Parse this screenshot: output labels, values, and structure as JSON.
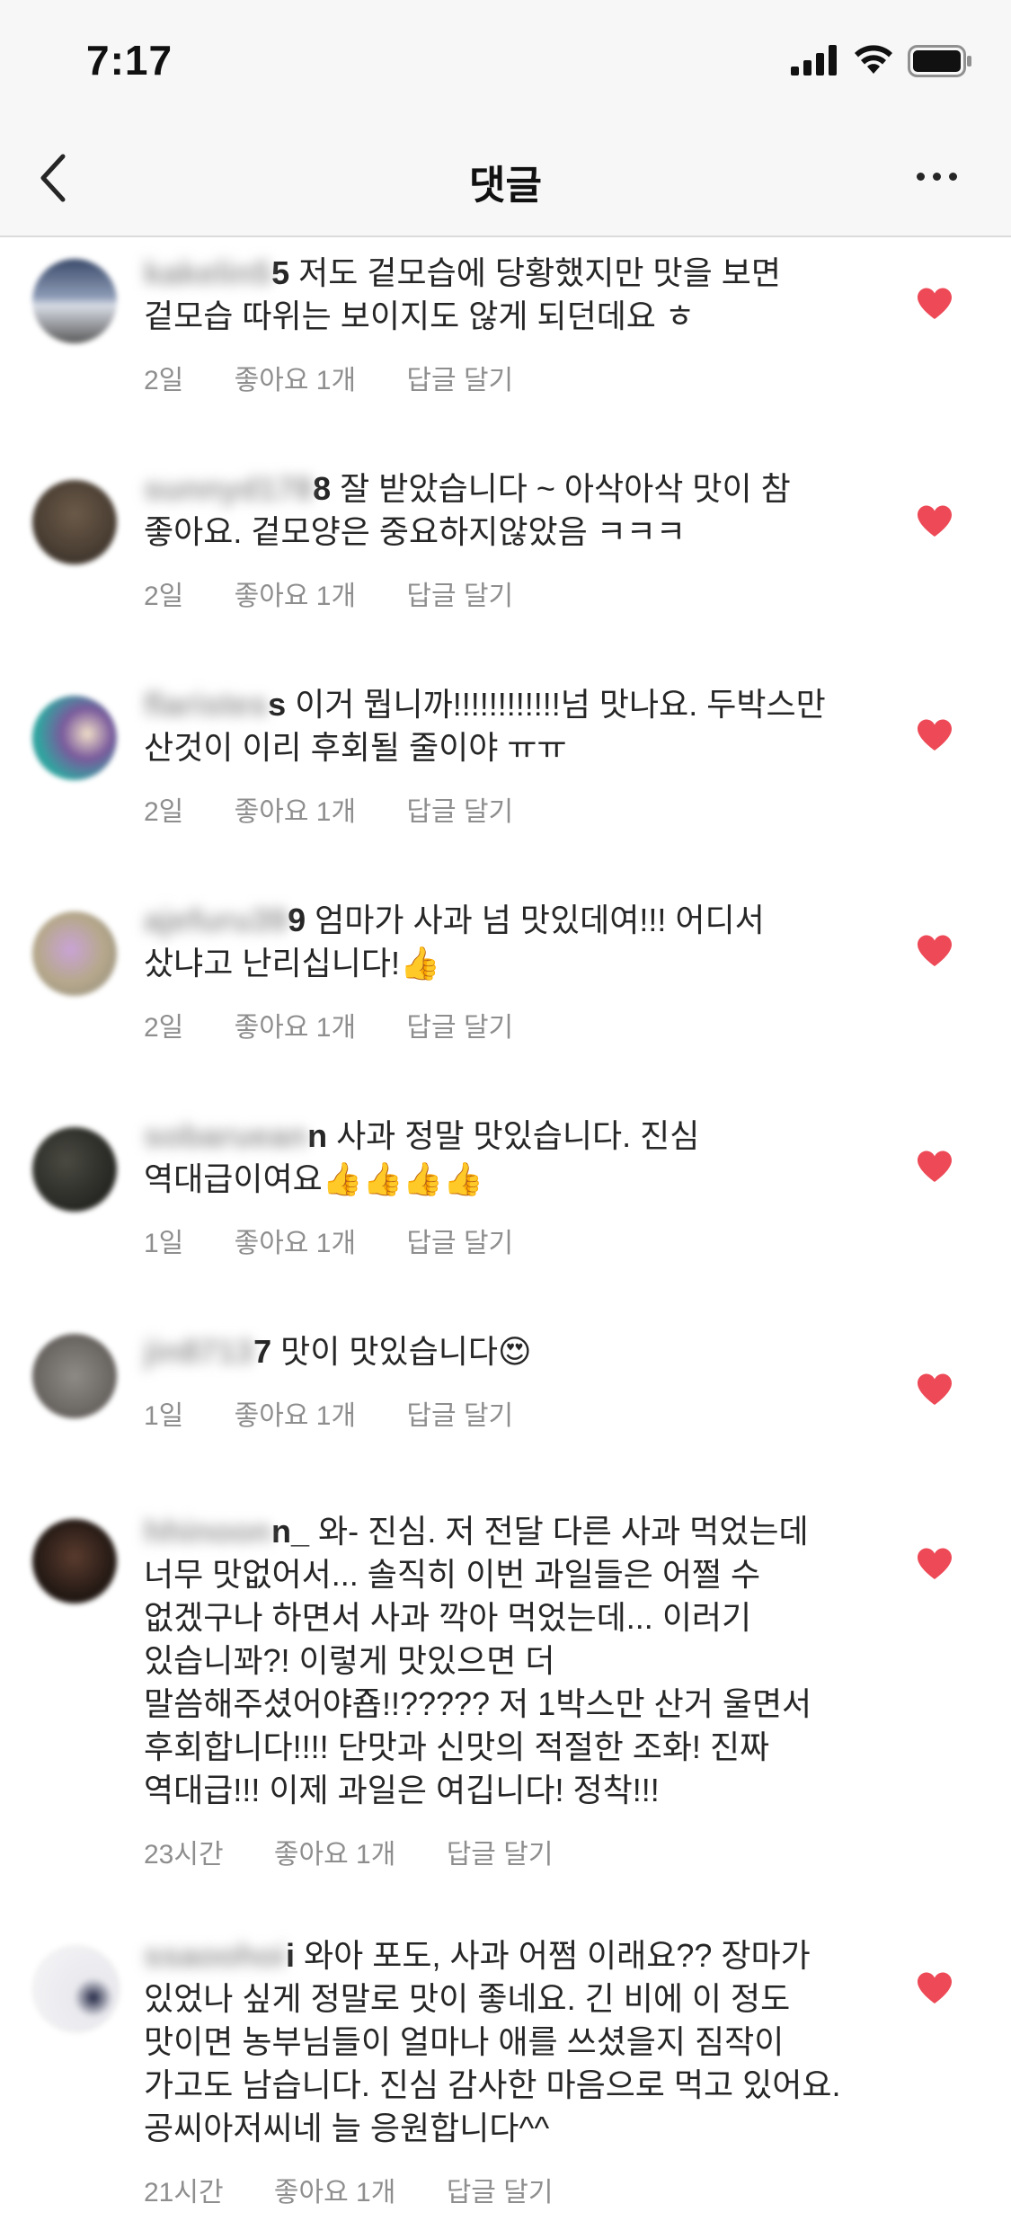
{
  "status_bar": {
    "time": "7:17"
  },
  "header": {
    "title": "댓글"
  },
  "colors": {
    "heart": "#ed4956",
    "meta_text": "#8e8e8e",
    "divider": "#dbdbdb"
  },
  "icons": {
    "back": "chevron-left-icon",
    "more": "more-dots-icon",
    "like": "heart-icon"
  },
  "comments": [
    {
      "username_suffix": "5",
      "username_blur": "kakelin5",
      "text": " 저도 겉모습에 당황했지만 맛을 보면 겉모습 따위는 보이지도 않게 되던데요 ㅎ",
      "time": "2일",
      "likes": "좋아요 1개",
      "reply": "답글 달기"
    },
    {
      "username_suffix": "8",
      "username_blur": "sunnyd178",
      "text": " 잘 받았습니다 ~ 아삭아삭 맛이 참 좋아요. 겉모양은 중요하지않았음 ㅋㅋㅋ",
      "time": "2일",
      "likes": "좋아요 1개",
      "reply": "답글 달기"
    },
    {
      "username_suffix": "s",
      "username_blur": "flaristes",
      "text": " 이거 뭡니까!!!!!!!!!!!!넘 맛나요. 두박스만 산것이 이리 후회될 줄이야 ㅠㅠ",
      "time": "2일",
      "likes": "좋아요 1개",
      "reply": "답글 달기"
    },
    {
      "username_suffix": "9",
      "username_blur": "ajefuru39",
      "text": " 엄마가 사과 넘 맛있데여!!! 어디서 샀냐고 난리십니다!",
      "emoji": "👍",
      "time": "2일",
      "likes": "좋아요 1개",
      "reply": "답글 달기"
    },
    {
      "username_suffix": "n",
      "username_blur": "sobaruean",
      "text": " 사과 정말 맛있습니다. 진심 역대급이여요",
      "emoji": "👍👍👍👍",
      "time": "1일",
      "likes": "좋아요 1개",
      "reply": "답글 달기"
    },
    {
      "username_suffix": "7",
      "username_blur": "jin8713",
      "text": " 맛이 맛있습니다",
      "emoji": "😍",
      "time": "1일",
      "likes": "좋아요 1개",
      "reply": "답글 달기"
    },
    {
      "username_suffix": "n_",
      "username_blur": "hhinoon",
      "text": " 와- 진심. 저 전달 다른 사과 먹었는데 너무 맛없어서... 솔직히 이번 과일들은 어쩔 수 없겠구나 하면서 사과 깍아 먹었는데... 이러기 있습니꽈?! 이렇게 맛있으면 더 말씀해주셨어야죱!!????? 저 1박스만 산거 울면서 후회합니다!!!! 단맛과 신맛의 적절한 조화! 진짜 역대급!!! 이제 과일은 여깁니다! 정착!!!",
      "time": "23시간",
      "likes": "좋아요 1개",
      "reply": "답글 달기"
    },
    {
      "username_suffix": "i",
      "username_blur": "ssaoohoi",
      "text": " 와아 포도, 사과 어쩜 이래요?? 장마가 있었나 싶게 정말로 맛이 좋네요. 긴 비에 이 정도 맛이면 농부님들이 얼마나 애를 쓰셨을지 짐작이 가고도 남습니다. 진심 감사한 마음으로 먹고 있어요. 공씨아저씨네 늘 응원합니다^^",
      "time": "21시간",
      "likes": "좋아요 1개",
      "reply": "답글 달기"
    }
  ]
}
